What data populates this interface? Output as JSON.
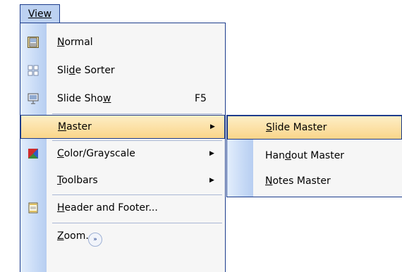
{
  "menubar": {
    "view": "View"
  },
  "menu": {
    "items": [
      {
        "label": "Normal",
        "accel_index": 0,
        "icon": "normal-view-icon",
        "shortcut": "",
        "arrow": false
      },
      {
        "label": "Slide Sorter",
        "accel_index": 3,
        "icon": "slide-sorter-icon",
        "shortcut": "",
        "arrow": false
      },
      {
        "label": "Slide Show",
        "accel_index": 9,
        "icon": "slide-show-icon",
        "shortcut": "F5",
        "arrow": false
      },
      {
        "label": "Master",
        "accel_index": 0,
        "icon": "",
        "shortcut": "",
        "arrow": true
      },
      {
        "label": "Color/Grayscale",
        "accel_index": 0,
        "icon": "color-grayscale-icon",
        "shortcut": "",
        "arrow": true
      },
      {
        "label": "Toolbars",
        "accel_index": 0,
        "icon": "",
        "shortcut": "",
        "arrow": true
      },
      {
        "label": "Header and Footer...",
        "accel_index": 0,
        "icon": "header-footer-icon",
        "shortcut": "",
        "arrow": false
      },
      {
        "label": "Zoom...",
        "accel_index": 0,
        "icon": "",
        "shortcut": "",
        "arrow": false
      }
    ]
  },
  "submenu": {
    "items": [
      {
        "label": "Slide Master",
        "accel_index": 0
      },
      {
        "label": "Handout Master",
        "accel_index": 3
      },
      {
        "label": "Notes Master",
        "accel_index": 0
      }
    ]
  },
  "colors": {
    "border": "#1c3c8c",
    "highlight": "#fad58a",
    "gutter": "#c7daf6"
  }
}
